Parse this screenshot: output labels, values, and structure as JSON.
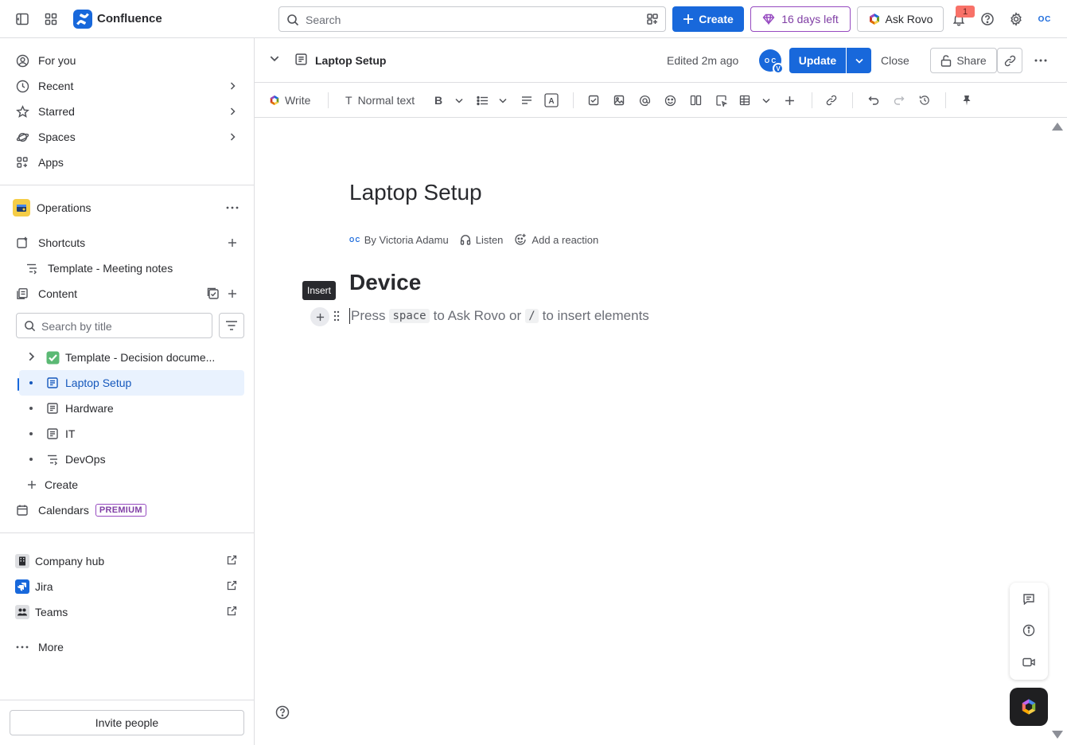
{
  "topbar": {
    "brand": "Confluence",
    "search_placeholder": "Search",
    "create_label": "Create",
    "trial_label": "16 days left",
    "rovo_label": "Ask Rovo",
    "notification_count": "1",
    "avatar_initials": "O C"
  },
  "sidebar": {
    "nav": [
      {
        "label": "For you"
      },
      {
        "label": "Recent"
      },
      {
        "label": "Starred"
      },
      {
        "label": "Spaces"
      },
      {
        "label": "Apps"
      }
    ],
    "space_name": "Operations",
    "shortcuts_label": "Shortcuts",
    "shortcut_item": "Template - Meeting notes",
    "content_label": "Content",
    "search_placeholder": "Search by title",
    "tree": [
      {
        "label": "Template - Decision docume..."
      },
      {
        "label": "Laptop Setup"
      },
      {
        "label": "Hardware"
      },
      {
        "label": "IT"
      },
      {
        "label": "DevOps"
      }
    ],
    "create_label": "Create",
    "calendars_label": "Calendars",
    "premium_tag": "PREMIUM",
    "apps": [
      {
        "label": "Company hub"
      },
      {
        "label": "Jira"
      },
      {
        "label": "Teams"
      }
    ],
    "more_label": "More",
    "invite_label": "Invite people"
  },
  "page_header": {
    "title": "Laptop Setup",
    "edited": "Edited 2m ago",
    "avatar_initials": "O C",
    "avatar_badge": "V",
    "update_label": "Update",
    "close_label": "Close",
    "share_label": "Share"
  },
  "toolbar": {
    "write_label": "Write",
    "text_style": "Normal text"
  },
  "editor": {
    "title": "Laptop Setup",
    "byline_author": "By Victoria Adamu",
    "listen_label": "Listen",
    "reaction_label": "Add a reaction",
    "heading": "Device",
    "tooltip": "Insert",
    "placeholder_1": "Press",
    "placeholder_key_1": "space",
    "placeholder_2": "to Ask Rovo or",
    "placeholder_key_2": "/",
    "placeholder_3": "to insert elements"
  },
  "colors": {
    "brand_blue": "#1868DB",
    "selected_bg": "#E9F2FE",
    "premium_purple": "#964AC0",
    "space_yellow": "#F5CD47"
  }
}
